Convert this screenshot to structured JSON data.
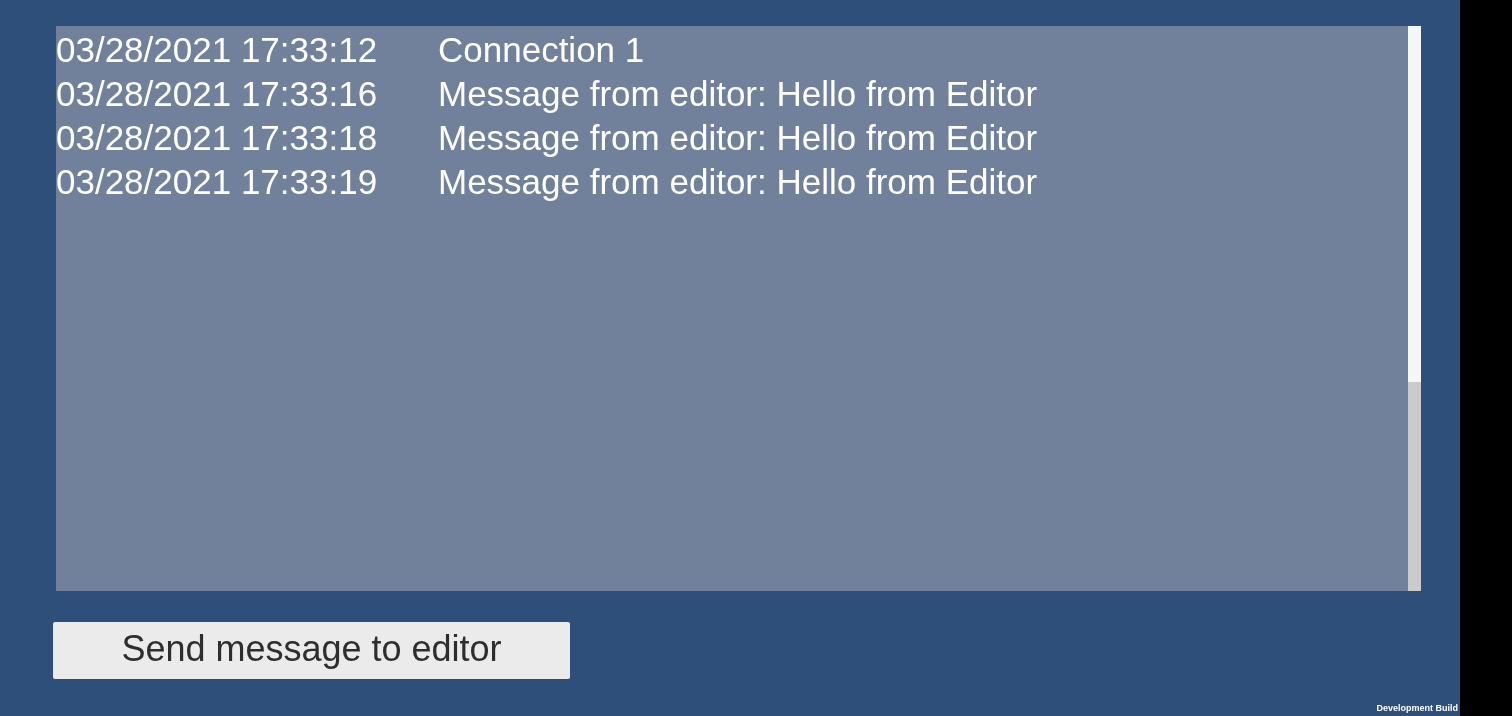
{
  "log": [
    {
      "time": "03/28/2021 17:33:12",
      "message": "Connection 1"
    },
    {
      "time": "03/28/2021 17:33:16",
      "message": "Message from editor: Hello from Editor"
    },
    {
      "time": "03/28/2021 17:33:18",
      "message": "Message from editor: Hello from Editor"
    },
    {
      "time": "03/28/2021 17:33:19",
      "message": "Message from editor: Hello from Editor"
    }
  ],
  "button": "Send message to editor",
  "build_label": "Development Build"
}
